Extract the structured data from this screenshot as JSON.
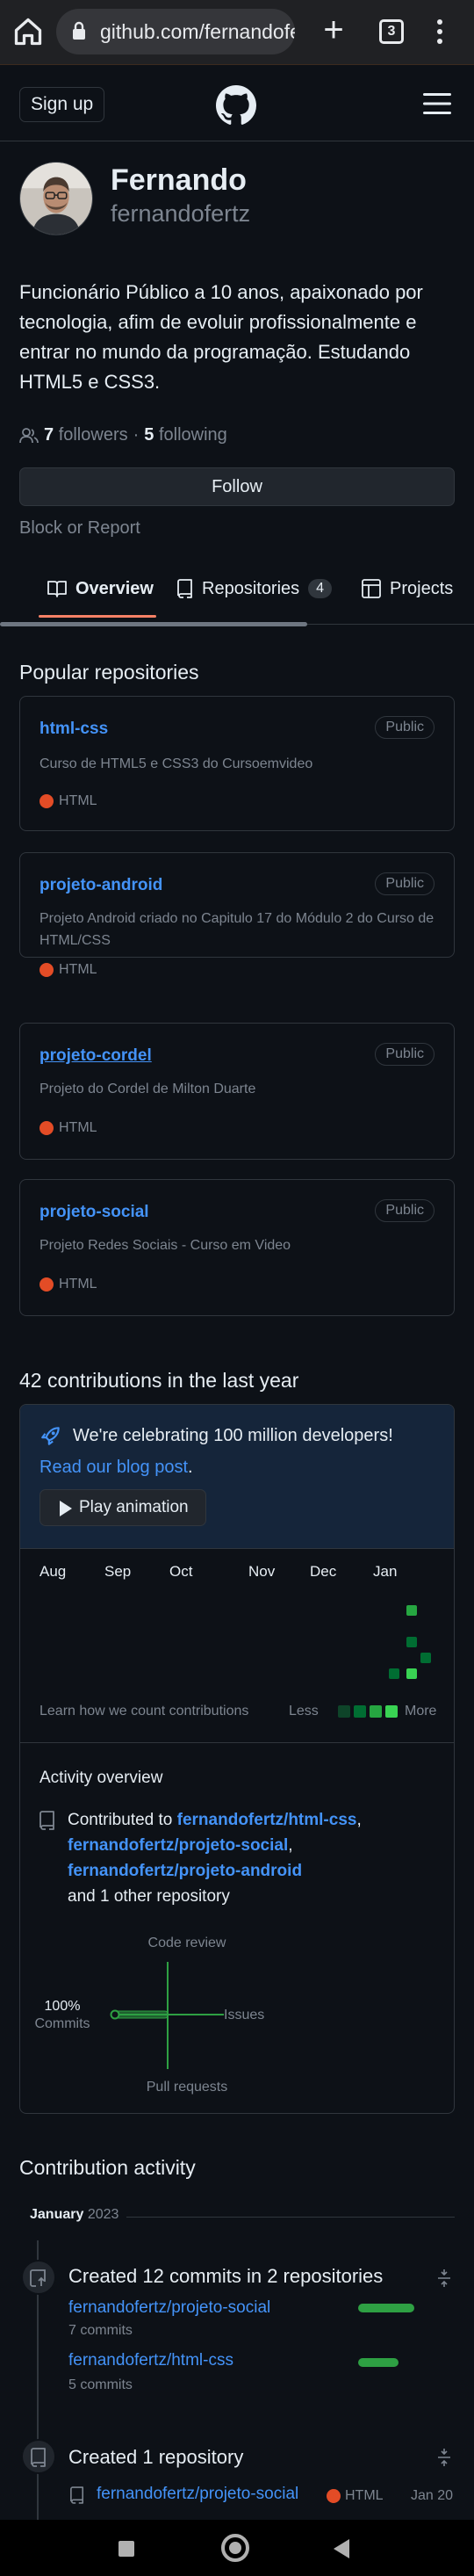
{
  "browser": {
    "url": "github.com/fernandofertz",
    "tab_count": "3"
  },
  "header": {
    "signup_label": "Sign up"
  },
  "profile": {
    "name": "Fernando",
    "login": "fernandofertz",
    "bio": "Funcionário Público a 10 anos, apaixonado por tecnologia, afim de evoluir profissionalmente e entrar no mundo da programação. Estudando HTML5 e CSS3.",
    "followers_count": "7",
    "followers_label": "followers",
    "separator": "·",
    "following_count": "5",
    "following_label": "following",
    "follow_label": "Follow",
    "block_label": "Block or Report"
  },
  "tabs": [
    {
      "label": "Overview"
    },
    {
      "label": "Repositories",
      "count": "4"
    },
    {
      "label": "Projects"
    }
  ],
  "popular": {
    "title": "Popular repositories",
    "repos": [
      {
        "name": "html-css",
        "visibility": "Public",
        "description": "Curso de HTML5 e CSS3 do Cursoemvideo",
        "language": "HTML"
      },
      {
        "name": "projeto-android",
        "visibility": "Public",
        "description": "Projeto Android criado no Capitulo 17 do Módulo 2 do Curso de HTML/CSS",
        "language": "HTML"
      },
      {
        "name": "projeto-cordel",
        "visibility": "Public",
        "description": "Projeto do Cordel de Milton Duarte",
        "language": "HTML"
      },
      {
        "name": "projeto-social",
        "visibility": "Public",
        "description": "Projeto Redes Sociais - Curso em Video",
        "language": "HTML"
      }
    ],
    "language_color": "#e34c26"
  },
  "contributions": {
    "title": "42 contributions in the last year",
    "banner_text": "We're celebrating 100 million developers!",
    "banner_link": "Read our blog post",
    "banner_link_suffix": ".",
    "play_label": "Play animation",
    "months": [
      "Aug",
      "Sep",
      "Oct",
      "Nov",
      "Dec",
      "Jan"
    ],
    "learn_label": "Learn how we count contributions",
    "less_label": "Less",
    "more_label": "More",
    "legend_colors": [
      "#161b22",
      "#0e4429",
      "#006d32",
      "#26a641",
      "#39d353"
    ]
  },
  "activity_overview": {
    "title": "Activity overview",
    "prefix": "Contributed to",
    "repo1": "fernandofertz/html-css",
    "comma1": ",",
    "repo2": "fernandofertz/projeto-social",
    "comma2": ",",
    "repo3": "fernandofertz/projeto-android",
    "suffix": "and 1 other repository",
    "axis": {
      "top": "Code review",
      "left_pct": "100%",
      "left": "Commits",
      "right": "Issues",
      "bottom": "Pull requests"
    },
    "commits_percent": 100
  },
  "activity": {
    "title": "Contribution activity",
    "month": "January",
    "year": "2023",
    "commits_title": "Created 12 commits in 2 repositories",
    "commit_repos": [
      {
        "name": "fernandofertz/projeto-social",
        "commits": "7 commits",
        "value": 7
      },
      {
        "name": "fernandofertz/html-css",
        "commits": "5 commits",
        "value": 5
      }
    ],
    "created_title": "Created 1 repository",
    "created_repo": "fernandofertz/projeto-social",
    "created_language": "HTML",
    "created_date": "Jan 20"
  }
}
